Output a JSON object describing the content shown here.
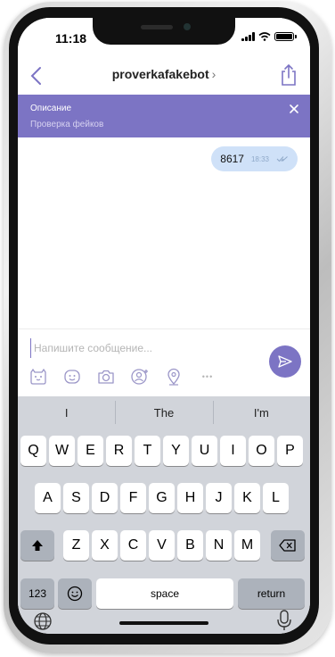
{
  "status_bar": {
    "time": "11:18"
  },
  "nav": {
    "title": "proverkafakebot",
    "title_chevron": "›"
  },
  "description": {
    "title": "Описание",
    "text": "Проверка фейков"
  },
  "messages": [
    {
      "text": "8617",
      "time": "18:33"
    }
  ],
  "composer": {
    "placeholder": "Напишите сообщение...",
    "more_label": "•••"
  },
  "keyboard": {
    "suggestions": [
      "I",
      "The",
      "I'm"
    ],
    "row1": [
      "Q",
      "W",
      "E",
      "R",
      "T",
      "Y",
      "U",
      "I",
      "O",
      "P"
    ],
    "row2": [
      "A",
      "S",
      "D",
      "F",
      "G",
      "H",
      "J",
      "K",
      "L"
    ],
    "row3": [
      "Z",
      "X",
      "C",
      "V",
      "B",
      "N",
      "M"
    ],
    "numbers_label": "123",
    "space_label": "space",
    "return_label": "return"
  },
  "colors": {
    "accent": "#7c74c4",
    "bubble": "#cfe1f8",
    "keyboard_bg": "#d1d4da"
  }
}
